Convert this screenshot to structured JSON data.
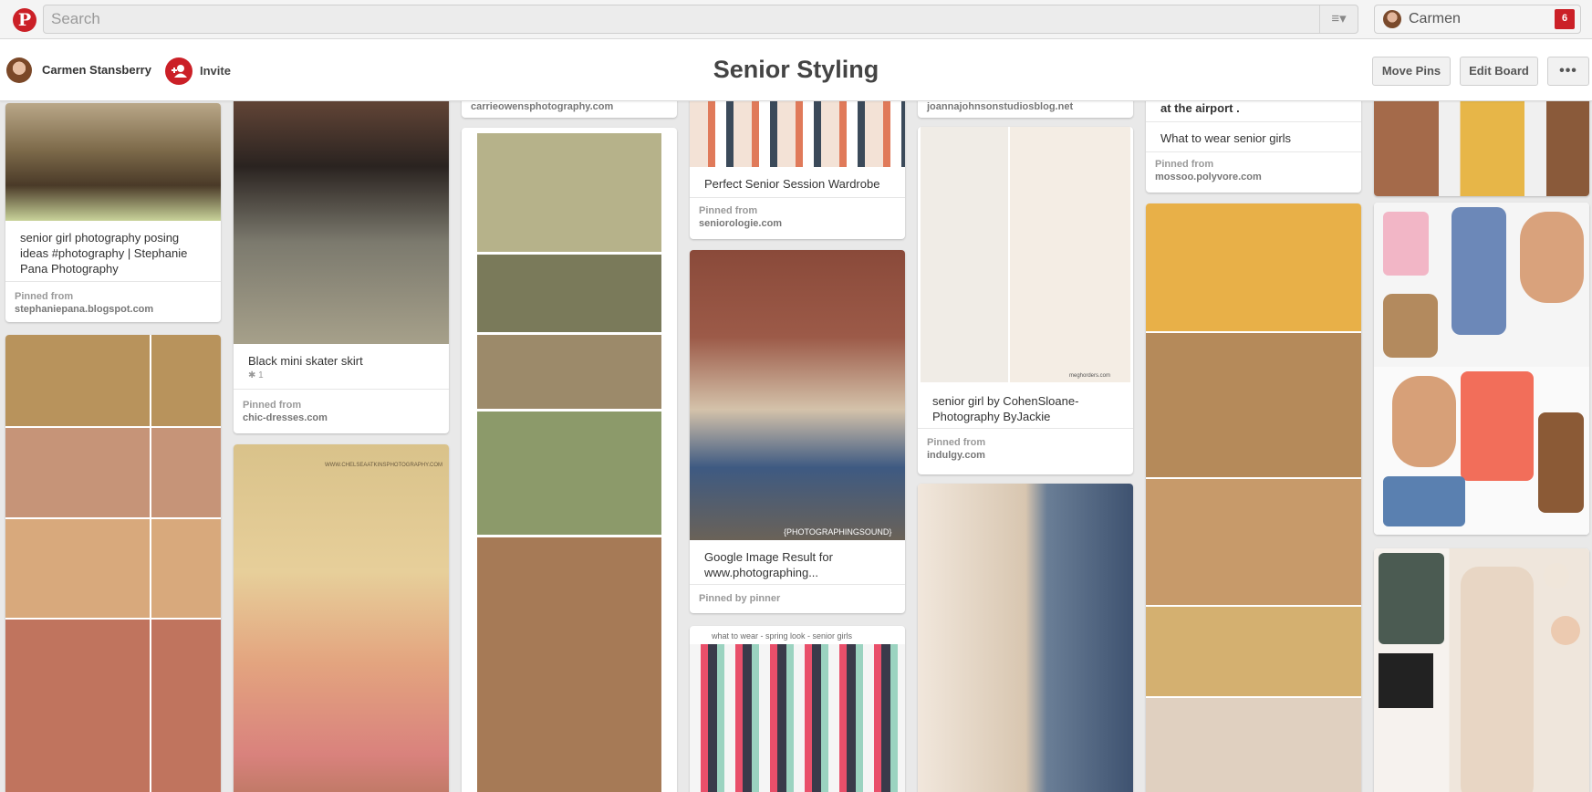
{
  "header": {
    "search_placeholder": "Search",
    "user_name": "Carmen",
    "notification_count": "6",
    "logo_glyph": "P",
    "menu_glyph": "≡▾"
  },
  "board": {
    "owner_name": "Carmen Stansberry",
    "invite_label": "Invite",
    "title": "Senior Styling",
    "move_pins": "Move Pins",
    "edit_board": "Edit Board",
    "more": "•••"
  },
  "pins": {
    "p1": {
      "desc": "senior girl photography posing ideas #photography | Stephanie Pana Photography",
      "pinned_label": "Pinned from",
      "source": "stephaniepana.blogspot.com"
    },
    "p2": {
      "desc": "Black mini skater skirt",
      "meta": "✱ 1",
      "pinned_label": "Pinned from",
      "source": "chic-dresses.com"
    },
    "p3": {
      "source": "carrieowensphotography.com"
    },
    "p5": {
      "desc": "Perfect Senior Session Wardrobe",
      "pinned_label": "Pinned from",
      "source": "seniorologie.com"
    },
    "p6": {
      "desc": "Google Image Result for www.photographing...",
      "pinned_label": "Pinned by pinner",
      "watermark": "{PHOTOGRAPHINGSOUND}"
    },
    "p7": {
      "overlay": "what to wear - spring look - senior girls"
    },
    "p8": {
      "source": "joannajohnsonstudiosblog.net"
    },
    "p9": {
      "desc": "senior girl by CohenSloane-Photography ByJackie",
      "pinned_label": "Pinned from",
      "source": "indulgy.com",
      "watermark": "meghorders.com"
    },
    "p11": {
      "quote": "love you is like waiting for a ship at the airport .",
      "desc": "What to wear senior girls",
      "pinned_label": "Pinned from",
      "source": "mossoo.polyvore.com"
    },
    "p4": {
      "watermark": "WWW.CHELSEAATKINSPHOTOGRAPHY.COM"
    }
  }
}
